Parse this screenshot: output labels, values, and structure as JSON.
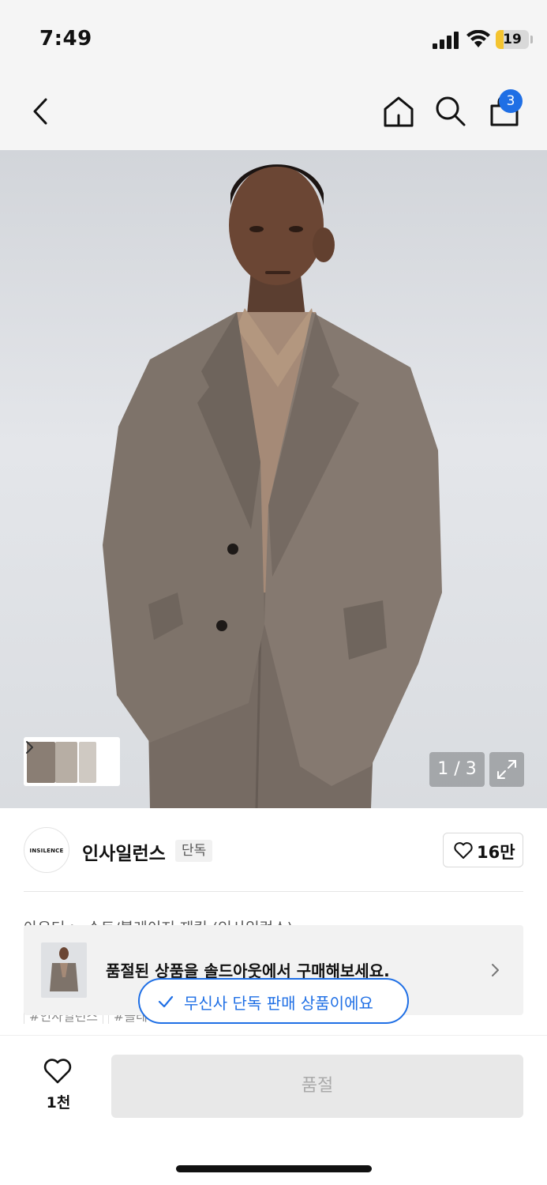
{
  "status_bar": {
    "time": "7:49",
    "battery": "19"
  },
  "nav": {
    "cart_count": "3",
    "icons": [
      "back-icon",
      "home-icon",
      "search-icon",
      "bag-icon"
    ]
  },
  "hero": {
    "page_counter": "1 / 3"
  },
  "brand": {
    "logo_text": "INSILENCE",
    "name": "인사일런스",
    "tag": "단독",
    "like_count": "16만"
  },
  "product": {
    "category_path": "아우터 > 슈트/블레이저 재킷 (인사일런스)",
    "tags": [
      "#인사일런스",
      "#블레이저"
    ]
  },
  "soldout_banner": {
    "text": "품절된 상품을 솔드아웃에서 구매해보세요."
  },
  "exclusive_pill": {
    "text": "무신사 단독 판매 상품이에요"
  },
  "bottom_bar": {
    "wish_count": "1천",
    "buy_label": "품절"
  },
  "colors": {
    "accent": "#1f6fe5",
    "badge": "#1f6fe5",
    "disabled_bg": "#e8e8e8"
  }
}
